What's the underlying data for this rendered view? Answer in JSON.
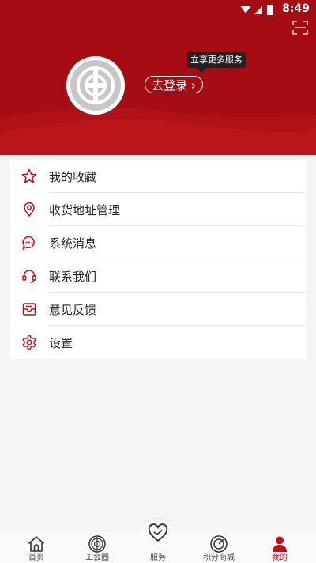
{
  "status_bar": {
    "time": "8:49"
  },
  "header": {
    "login_label": "去登录",
    "tooltip": "立享更多服务"
  },
  "menu": {
    "items": [
      {
        "label": "我的收藏",
        "icon": "star-icon"
      },
      {
        "label": "收货地址管理",
        "icon": "location-pin-icon"
      },
      {
        "label": "系统消息",
        "icon": "chat-bubble-icon"
      },
      {
        "label": "联系我们",
        "icon": "headset-icon"
      },
      {
        "label": "意见反馈",
        "icon": "inbox-icon"
      },
      {
        "label": "设置",
        "icon": "gear-icon"
      }
    ]
  },
  "tabbar": {
    "tabs": [
      {
        "label": "首页",
        "icon": "home-icon"
      },
      {
        "label": "工会圈",
        "icon": "union-emblem-icon"
      },
      {
        "label": "服务",
        "icon": "heart-icon"
      },
      {
        "label": "积分商城",
        "icon": "points-mall-icon"
      },
      {
        "label": "我的",
        "icon": "person-icon"
      }
    ],
    "active_index": 4
  },
  "colors": {
    "brand_red": "#a50d12",
    "accent_red": "#c40e16"
  }
}
